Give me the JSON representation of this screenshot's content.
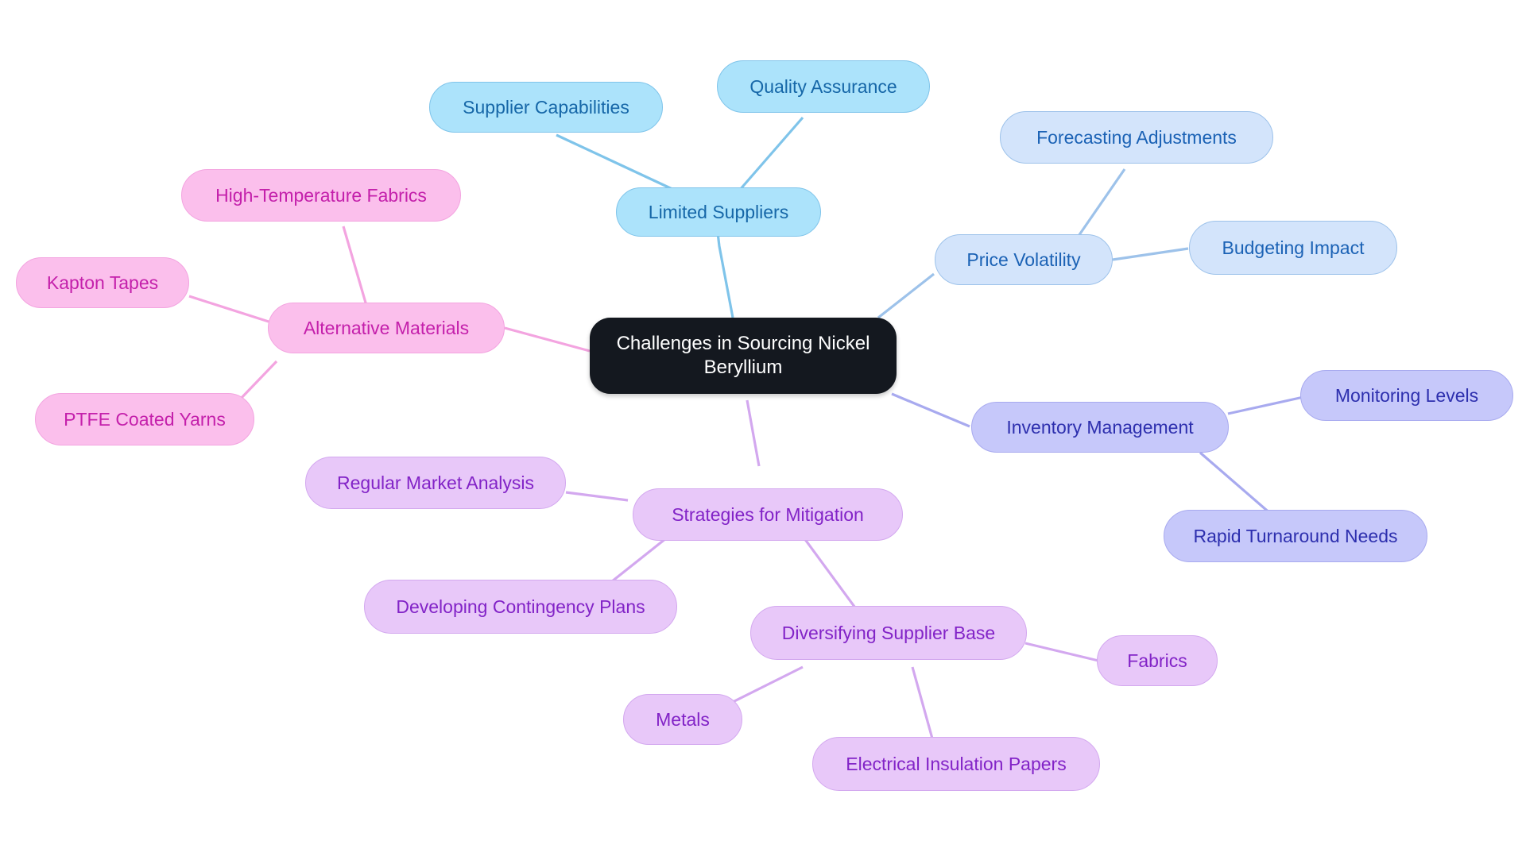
{
  "diagram": {
    "type": "mindmap",
    "title": "Challenges in Sourcing Nickel Beryllium",
    "background_color": "#ffffff",
    "root": {
      "id": "root",
      "label": "Challenges in Sourcing Nickel Beryllium",
      "fill": "#14181f",
      "text_color": "#ffffff"
    },
    "palette": {
      "blue_fill": "#ace3fb",
      "blue_text": "#1667a8",
      "blue_stroke": "#7fc4ea",
      "paleblue_fill": "#d3e4fb",
      "paleblue_text": "#1b62b5",
      "paleblue_stroke": "#9dc2ea",
      "pink_fill": "#fbbfec",
      "pink_text": "#c420ab",
      "pink_stroke": "#f3a4e0",
      "periwinkle_fill": "#c6c8fa",
      "periwinkle_text": "#2d2fae",
      "periwinkle_stroke": "#a8aaef",
      "violet_fill": "#e8c8f9",
      "violet_text": "#8223c7",
      "violet_stroke": "#d3a8ef"
    },
    "branches": [
      {
        "id": "limited-suppliers",
        "label": "Limited Suppliers",
        "color_family": "blue",
        "children": [
          {
            "id": "supplier-capabilities",
            "label": "Supplier Capabilities"
          },
          {
            "id": "quality-assurance",
            "label": "Quality Assurance"
          }
        ]
      },
      {
        "id": "price-volatility",
        "label": "Price Volatility",
        "color_family": "paleblue",
        "children": [
          {
            "id": "forecasting-adjustments",
            "label": "Forecasting Adjustments"
          },
          {
            "id": "budgeting-impact",
            "label": "Budgeting Impact"
          }
        ]
      },
      {
        "id": "alternative-materials",
        "label": "Alternative Materials",
        "color_family": "pink",
        "children": [
          {
            "id": "high-temperature-fabrics",
            "label": "High-Temperature Fabrics"
          },
          {
            "id": "kapton-tapes",
            "label": "Kapton Tapes"
          },
          {
            "id": "ptfe-coated-yarns",
            "label": "PTFE Coated Yarns"
          }
        ]
      },
      {
        "id": "inventory-management",
        "label": "Inventory Management",
        "color_family": "periwinkle",
        "children": [
          {
            "id": "monitoring-levels",
            "label": "Monitoring Levels"
          },
          {
            "id": "rapid-turnaround-needs",
            "label": "Rapid Turnaround Needs"
          }
        ]
      },
      {
        "id": "strategies-for-mitigation",
        "label": "Strategies for Mitigation",
        "color_family": "violet",
        "children": [
          {
            "id": "regular-market-analysis",
            "label": "Regular Market Analysis"
          },
          {
            "id": "developing-contingency-plans",
            "label": "Developing Contingency Plans"
          },
          {
            "id": "diversifying-supplier-base",
            "label": "Diversifying Supplier Base",
            "children": [
              {
                "id": "fabrics",
                "label": "Fabrics"
              },
              {
                "id": "metals",
                "label": "Metals"
              },
              {
                "id": "electrical-insulation-papers",
                "label": "Electrical Insulation Papers"
              }
            ]
          }
        ]
      }
    ],
    "nodes": {
      "root": {
        "label": "Challenges in Sourcing Nickel Beryllium"
      },
      "limited_suppliers": {
        "label": "Limited Suppliers"
      },
      "supplier_capabilities": {
        "label": "Supplier Capabilities"
      },
      "quality_assurance": {
        "label": "Quality Assurance"
      },
      "price_volatility": {
        "label": "Price Volatility"
      },
      "forecasting_adjustments": {
        "label": "Forecasting Adjustments"
      },
      "budgeting_impact": {
        "label": "Budgeting Impact"
      },
      "alternative_materials": {
        "label": "Alternative Materials"
      },
      "high_temperature_fabrics": {
        "label": "High-Temperature Fabrics"
      },
      "kapton_tapes": {
        "label": "Kapton Tapes"
      },
      "ptfe_coated_yarns": {
        "label": "PTFE Coated Yarns"
      },
      "inventory_management": {
        "label": "Inventory Management"
      },
      "monitoring_levels": {
        "label": "Monitoring Levels"
      },
      "rapid_turnaround_needs": {
        "label": "Rapid Turnaround Needs"
      },
      "strategies_for_mitigation": {
        "label": "Strategies for Mitigation"
      },
      "regular_market_analysis": {
        "label": "Regular Market Analysis"
      },
      "developing_contingency_plans": {
        "label": "Developing Contingency Plans"
      },
      "diversifying_supplier_base": {
        "label": "Diversifying Supplier Base"
      },
      "fabrics": {
        "label": "Fabrics"
      },
      "metals": {
        "label": "Metals"
      },
      "electrical_insulation_papers": {
        "label": "Electrical Insulation Papers"
      }
    }
  }
}
